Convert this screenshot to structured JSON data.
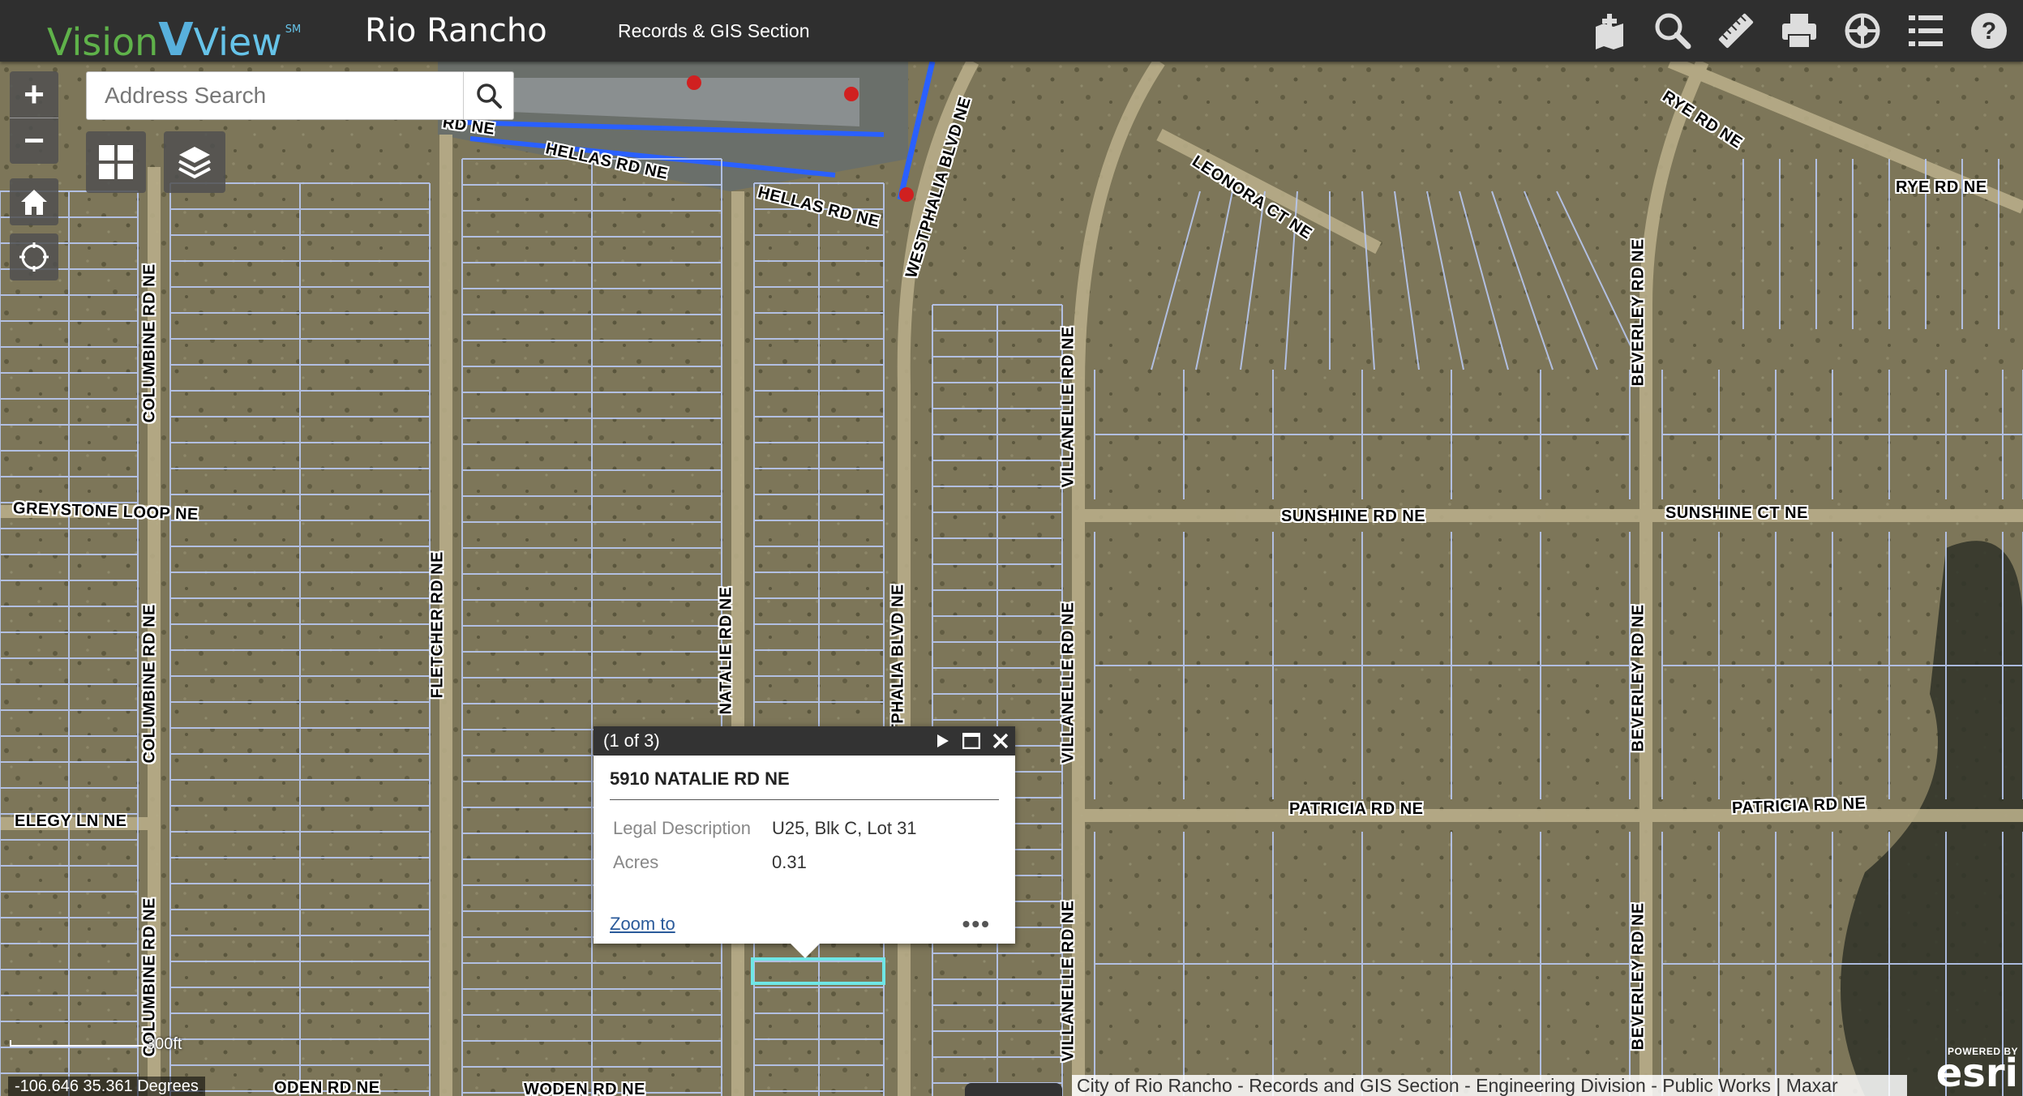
{
  "header": {
    "logo_word1": "Vision",
    "logo_word2": "View",
    "logo_mark": "SM",
    "city": "Rio Rancho",
    "section": "Records & GIS Section",
    "tools": [
      {
        "name": "add-feature-icon"
      },
      {
        "name": "search-icon"
      },
      {
        "name": "measure-icon"
      },
      {
        "name": "print-icon"
      },
      {
        "name": "basemap-gallery-icon"
      },
      {
        "name": "legend-icon"
      },
      {
        "name": "help-icon"
      }
    ]
  },
  "search": {
    "placeholder": "Address Search"
  },
  "controls": {
    "zoom_in": "+",
    "zoom_out": "−"
  },
  "roads": [
    {
      "text": "RD NE"
    },
    {
      "text": "HELLAS RD NE"
    },
    {
      "text": "HELLAS RD NE"
    },
    {
      "text": "WESTPHALIA BLVD NE"
    },
    {
      "text": "LEONORA CT NE"
    },
    {
      "text": "RYE RD NE"
    },
    {
      "text": "RYE RD NE"
    },
    {
      "text": "COLUMBINE RD NE"
    },
    {
      "text": "BEVERLEY RD NE"
    },
    {
      "text": "VILLANELLE RD NE"
    },
    {
      "text": "GREYSTONE LOOP NE"
    },
    {
      "text": "SUNSHINE RD NE"
    },
    {
      "text": "SUNSHINE CT NE"
    },
    {
      "text": "FLETCHER RD NE"
    },
    {
      "text": "NATALIE RD NE"
    },
    {
      "text": "TPHALIA BLVD NE"
    },
    {
      "text": "COLUMBINE RD NE"
    },
    {
      "text": "VILLANELLE RD NE"
    },
    {
      "text": "BEVERLEY RD NE"
    },
    {
      "text": "ELEGY LN NE"
    },
    {
      "text": "PATRICIA RD NE"
    },
    {
      "text": "PATRICIA RD NE"
    },
    {
      "text": "COLUMBINE RD NE"
    },
    {
      "text": "VILLANELLE RD NE"
    },
    {
      "text": "BEVERLEY RD NE"
    },
    {
      "text": "ODEN RD NE"
    },
    {
      "text": "WODEN RD NE"
    }
  ],
  "popup": {
    "count": "(1 of 3)",
    "title": "5910 NATALIE RD NE",
    "attributes": [
      {
        "key": "Legal Description",
        "value": "U25, Blk C, Lot 31"
      },
      {
        "key": "Acres",
        "value": "0.31"
      }
    ],
    "zoom_to": "Zoom to",
    "more": "•••"
  },
  "footer": {
    "scale": "300ft",
    "coords": "-106.646 35.361 Degrees",
    "attribution": "City of Rio Rancho - Records and GIS Section - Engineering Division - Public Works | Maxar",
    "esri_powered": "POWERED BY",
    "esri_brand": "esri"
  },
  "colors": {
    "header_bg": "#2f2f2f",
    "parcel_line": "#b8c8f0",
    "highlight": "#6ee6e6",
    "terrain": "#7a7458"
  }
}
